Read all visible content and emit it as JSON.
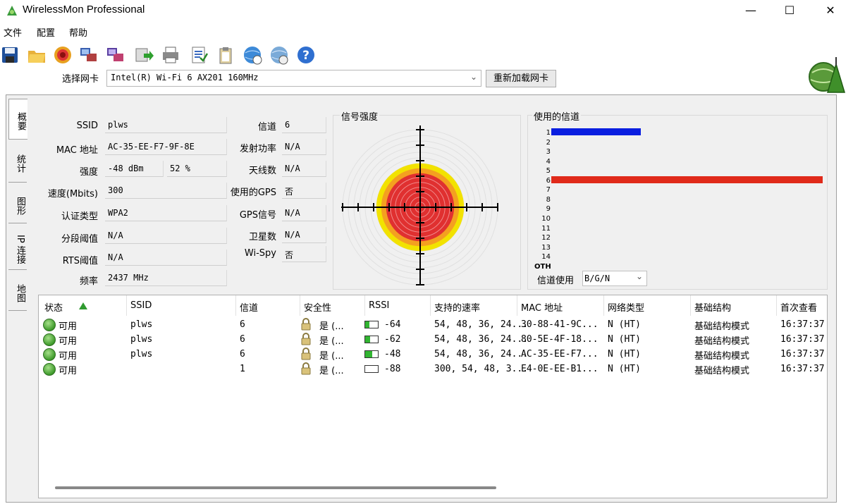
{
  "window": {
    "title": "WirelessMon Professional",
    "minimize": "—",
    "maximize": "☐",
    "close": "✕"
  },
  "menu": [
    "文件",
    "配置",
    "帮助"
  ],
  "toolbar": {
    "icons": [
      "save-icon",
      "open-folder-icon",
      "target-icon",
      "network-adapter-icon",
      "network-compare-icon",
      "export-icon",
      "print-icon",
      "report-icon",
      "clipboard-icon",
      "globe-info-icon",
      "globe-refresh-icon",
      "help-icon"
    ],
    "card_label": "选择网卡",
    "card_value": "Intel(R) Wi-Fi 6 AX201 160MHz",
    "reload_label": "重新加载网卡"
  },
  "tabs": [
    "概要",
    "统计",
    "图形",
    "IP 连接",
    "地图"
  ],
  "info_left": [
    {
      "label": "SSID",
      "value": "plws"
    },
    {
      "label": "MAC 地址",
      "value": "AC-35-EE-F7-9F-8E"
    },
    {
      "label": "强度",
      "value": "-48 dBm",
      "value2": "52 %"
    },
    {
      "label": "速度(Mbits)",
      "value": "300"
    },
    {
      "label": "认证类型",
      "value": "WPA2"
    },
    {
      "label": "分段阈值",
      "value": "N/A"
    },
    {
      "label": "RTS阈值",
      "value": "N/A"
    },
    {
      "label": "频率",
      "value": "2437 MHz"
    }
  ],
  "info_right": [
    {
      "label": "信道",
      "value": "6"
    },
    {
      "label": "发射功率",
      "value": "N/A"
    },
    {
      "label": "天线数",
      "value": "N/A"
    },
    {
      "label": "使用的GPS",
      "value": "否"
    },
    {
      "label": "GPS信号",
      "value": "N/A"
    },
    {
      "label": "卫星数",
      "value": "N/A"
    },
    {
      "label": "Wi-Spy",
      "value": "否"
    }
  ],
  "signal": {
    "title": "信号强度",
    "strength_percent": 52,
    "colors": {
      "yellow": "#f2e200",
      "orange": "#f4a020",
      "red": "#e03030"
    }
  },
  "channels": {
    "title": "使用的信道",
    "labels": [
      "1",
      "2",
      "3",
      "4",
      "5",
      "6",
      "7",
      "8",
      "9",
      "10",
      "11",
      "12",
      "13",
      "14",
      "OTH"
    ],
    "bars": [
      {
        "channel": "1",
        "fraction": 0.33,
        "color": "#0a1ee0"
      },
      {
        "channel": "6",
        "fraction": 1.0,
        "color": "#e02a1a"
      }
    ],
    "use_label": "信道使用",
    "use_value": "B/G/N"
  },
  "list": {
    "columns": [
      "状态",
      "SSID",
      "信道",
      "安全性",
      "RSSI",
      "支持的速率",
      "MAC 地址",
      "网络类型",
      "基础结构",
      "首次查看"
    ],
    "rows": [
      {
        "status": "可用",
        "ssid": "plws",
        "channel": "6",
        "security": "是 (...",
        "rssi": "-64",
        "rssi_level": 0.35,
        "rates": "54, 48, 36, 24...",
        "mac": "30-88-41-9C...",
        "type": "N (HT)",
        "infra": "基础结构模式",
        "first_seen": "16:37:37"
      },
      {
        "status": "可用",
        "ssid": "plws",
        "channel": "6",
        "security": "是 (...",
        "rssi": "-62",
        "rssi_level": 0.4,
        "rates": "54, 48, 36, 24...",
        "mac": "80-5E-4F-18...",
        "type": "N (HT)",
        "infra": "基础结构模式",
        "first_seen": "16:37:37"
      },
      {
        "status": "可用",
        "ssid": "plws",
        "channel": "6",
        "security": "是 (...",
        "rssi": "-48",
        "rssi_level": 0.55,
        "rates": "54, 48, 36, 24...",
        "mac": "AC-35-EE-F7...",
        "type": "N (HT)",
        "infra": "基础结构模式",
        "first_seen": "16:37:37"
      },
      {
        "status": "可用",
        "ssid": "",
        "channel": "1",
        "security": "是 (...",
        "rssi": "-88",
        "rssi_level": 0.0,
        "rates": "300, 54, 48, 3...",
        "mac": "E4-0E-EE-B1...",
        "type": "N (HT)",
        "infra": "基础结构模式",
        "first_seen": "16:37:37"
      }
    ]
  }
}
